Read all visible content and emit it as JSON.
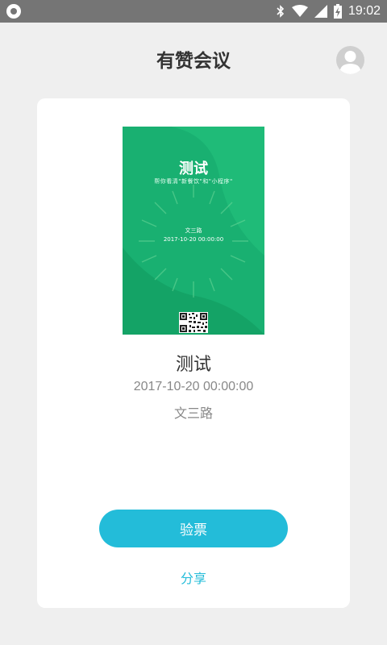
{
  "status_bar": {
    "time": "19:02",
    "icons": [
      "bluetooth-icon",
      "wifi-icon",
      "signal-icon",
      "battery-charging-icon"
    ]
  },
  "header": {
    "title": "有赞会议",
    "avatar_icon": "avatar-icon"
  },
  "poster": {
    "title": "测试",
    "subtitle": "帮你看清\"新餐饮\"和\"小程序\"",
    "location": "文三路",
    "time": "2017-10-20 00:00:00",
    "qr_icon": "qr-code-icon",
    "colors": {
      "background": "#19b071",
      "accent": "#5fd08f"
    }
  },
  "event": {
    "title": "测试",
    "time": "2017-10-20 00:00:00",
    "location": "文三路"
  },
  "actions": {
    "check_ticket_label": "验票",
    "share_label": "分享"
  },
  "colors": {
    "status_bar": "#757575",
    "page_background": "#efefef",
    "accent": "#23bcd9"
  }
}
